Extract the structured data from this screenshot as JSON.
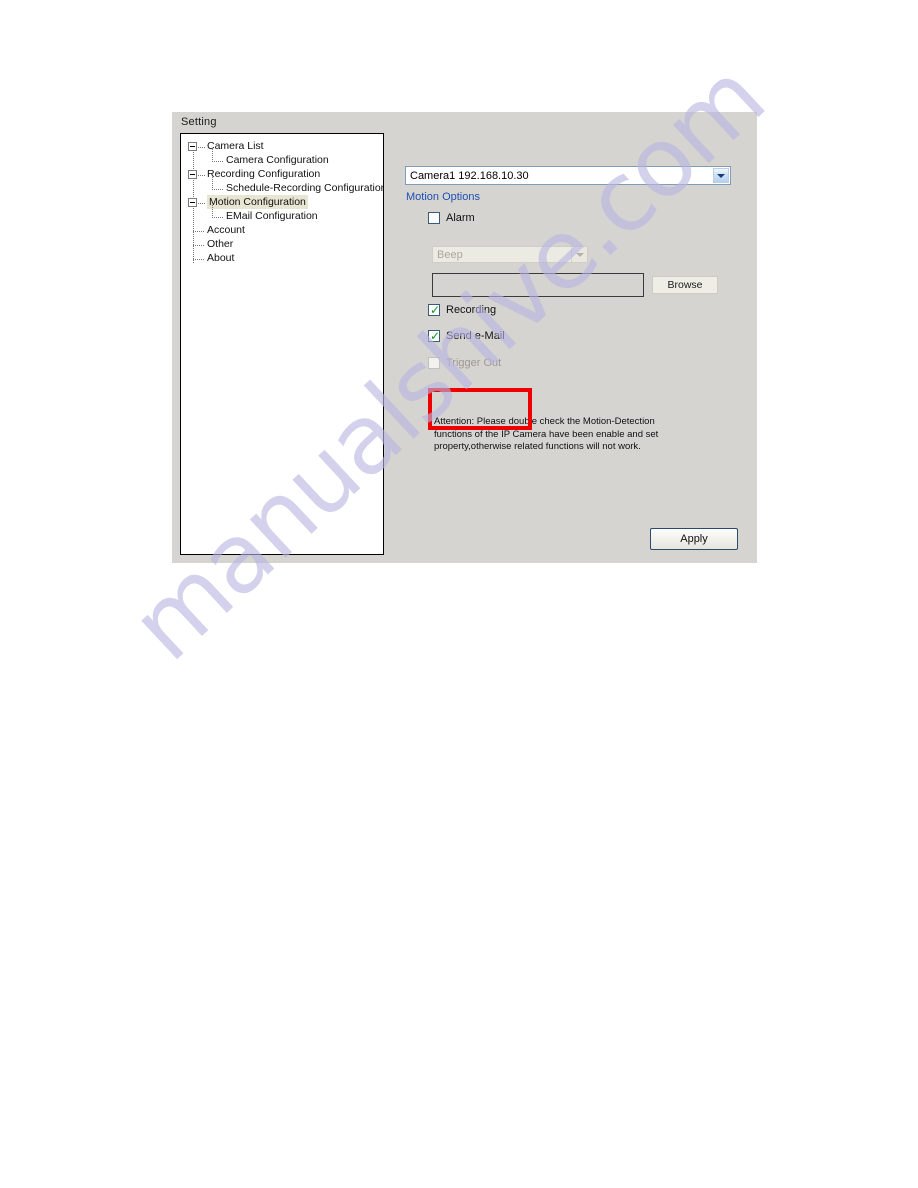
{
  "dialog": {
    "group_title": "Setting"
  },
  "tree": {
    "items": [
      {
        "label": "Camera List",
        "level": 0,
        "expander": true,
        "selected": false
      },
      {
        "label": "Camera Configuration",
        "level": 1,
        "expander": false,
        "selected": false
      },
      {
        "label": "Recording Configuration",
        "level": 0,
        "expander": true,
        "selected": false
      },
      {
        "label": "Schedule-Recording Configuration",
        "level": 1,
        "expander": false,
        "selected": false
      },
      {
        "label": "Motion Configuration",
        "level": 0,
        "expander": true,
        "selected": true
      },
      {
        "label": "EMail Configuration",
        "level": 1,
        "expander": false,
        "selected": false
      },
      {
        "label": "Account",
        "level": 0,
        "expander": false,
        "selected": false
      },
      {
        "label": "Other",
        "level": 0,
        "expander": false,
        "selected": false
      },
      {
        "label": "About",
        "level": 0,
        "expander": false,
        "selected": false
      }
    ]
  },
  "panel": {
    "camera_select": {
      "value": "Camera1 192.168.10.30",
      "arrow_icon": "chevron-down-icon"
    },
    "section_label": "Motion Options",
    "section_label_color": "#1e4fb4",
    "checkboxes": [
      {
        "name": "alarm",
        "label": "Alarm",
        "checked": false,
        "disabled": false
      },
      {
        "name": "recording",
        "label": "Recording",
        "checked": true,
        "disabled": false
      },
      {
        "name": "send_email",
        "label": "Send e-Mail",
        "checked": true,
        "disabled": false
      },
      {
        "name": "trigger_out",
        "label": "Trigger Out",
        "checked": false,
        "disabled": true
      }
    ],
    "sound_select": {
      "value": "Beep",
      "disabled": true,
      "arrow_icon": "chevron-down-icon"
    },
    "path_field": {
      "value": "",
      "placeholder": ""
    },
    "browse_label": "Browse",
    "attention_text": "Attention: Please double check the Motion-Detection functions of the IP Camera have been enable and set property,otherwise related functions will not work.",
    "apply_label": "Apply"
  },
  "highlight": {
    "color": "#ee0000",
    "target": "recording-checkbox"
  },
  "watermark": {
    "text": "manualshive.com",
    "color": "#b9b5e2"
  }
}
